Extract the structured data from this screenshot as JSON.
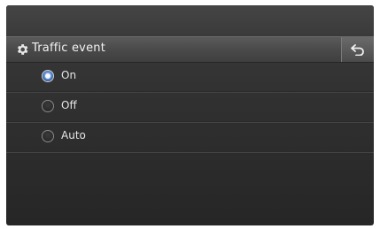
{
  "header": {
    "title": "Traffic event"
  },
  "icons": {
    "settings": "gear-icon",
    "back": "back-arrow-icon"
  },
  "options": [
    {
      "label": "On",
      "selected": true
    },
    {
      "label": "Off",
      "selected": false
    },
    {
      "label": "Auto",
      "selected": false
    }
  ],
  "colors": {
    "selected_radio": "#4a78c0",
    "text": "#e6e6e6"
  }
}
